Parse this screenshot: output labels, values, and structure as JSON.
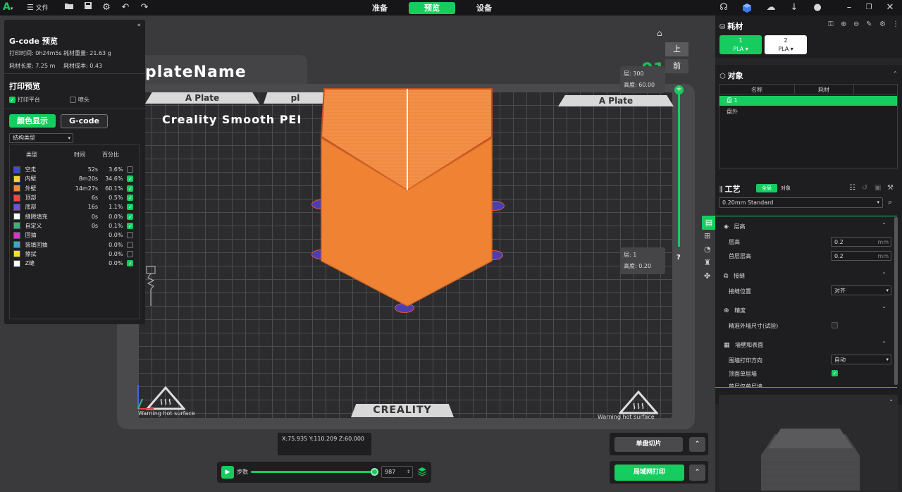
{
  "topbar": {
    "file_label": "文件",
    "tabs": [
      {
        "label": "准备"
      },
      {
        "label": "预览"
      },
      {
        "label": "设备"
      }
    ],
    "active_tab": "预览",
    "accent": "#17cc5f"
  },
  "viewport": {
    "plate_name": "plateName",
    "bed_labels": [
      "A Plate",
      "pl",
      "A Plate"
    ],
    "bed_title": "Creality Smooth PEI",
    "brand": "CREALITY",
    "warning_left": "Warning hot surface",
    "warning_right": "Warning hot surface",
    "view_top": "上",
    "view_front": "前",
    "view_number": "01",
    "layer_top": {
      "layer": "层: 300",
      "height": "高度: 60.00"
    },
    "layer_bottom": {
      "layer": "层: 1",
      "height": "高度: 0.20"
    },
    "help": "?",
    "coords": "X:75.935  Y:110.209  Z:60.000",
    "step_label": "步数",
    "step_value": "987",
    "slice_single": "单盘切片",
    "print_lan": "局域网打印",
    "model_color": "#f08a3c"
  },
  "left_panel": {
    "title": "G-code 预览",
    "print_time": "打印时间: 0h24m5s",
    "filament_weight": "耗材重量: 21.63 g",
    "filament_length": "耗材长度: 7.25 m",
    "filament_cost": "耗材成本: 0.43",
    "print_preview": "打印预览",
    "bed_option": "打印平台",
    "nozzle_option": "喷头",
    "color_button": "颜色显示",
    "gcode_button": "G-code",
    "select_value": "结构类型",
    "col_type": "类型",
    "col_time": "时间",
    "col_percent": "百分比",
    "rows": [
      {
        "name": "空走",
        "time": "52s",
        "pct": "3.6%",
        "color": "#3a4bd6",
        "checked": false
      },
      {
        "name": "内壁",
        "time": "8m20s",
        "pct": "34.6%",
        "color": "#f5d23a",
        "checked": true
      },
      {
        "name": "外壁",
        "time": "14m27s",
        "pct": "60.1%",
        "color": "#f08a3c",
        "checked": true
      },
      {
        "name": "顶部",
        "time": "6s",
        "pct": "0.5%",
        "color": "#e84a4a",
        "checked": true
      },
      {
        "name": "底部",
        "time": "16s",
        "pct": "1.1%",
        "color": "#7a4be0",
        "checked": true
      },
      {
        "name": "缝隙填充",
        "time": "0s",
        "pct": "0.0%",
        "color": "#ffffff",
        "checked": true
      },
      {
        "name": "自定义",
        "time": "0s",
        "pct": "0.1%",
        "color": "#3bb27a",
        "checked": true
      },
      {
        "name": "回抽",
        "time": "",
        "pct": "0.0%",
        "color": "#d536c8",
        "checked": false
      },
      {
        "name": "装填回抽",
        "time": "",
        "pct": "0.0%",
        "color": "#3aa7c7",
        "checked": false
      },
      {
        "name": "擦拭",
        "time": "",
        "pct": "0.0%",
        "color": "#f2e325",
        "checked": false
      },
      {
        "name": "Z缝",
        "time": "",
        "pct": "0.0%",
        "color": "#ffffff",
        "checked": true
      }
    ]
  },
  "right_panel": {
    "filament_title": "耗材",
    "filaments": [
      {
        "num": "1",
        "type": "PLA",
        "color": "#17cc5f"
      },
      {
        "num": "2",
        "type": "PLA",
        "color": "#ffffff"
      }
    ],
    "objects_title": "对象",
    "col_name": "名称",
    "col_filament": "耗材",
    "plate_item": "盘 1",
    "outside_item": "盘外",
    "process_title": "工艺",
    "tab_global": "全局",
    "tab_object": "对象",
    "preset": "0.20mm Standard",
    "sections": {
      "layer_height": "层高",
      "seam": "接缝",
      "precision": "精度",
      "walls": "墙壁和表面"
    },
    "params": {
      "layer_height_label": "层高",
      "layer_height_value": "0.2",
      "first_layer_label": "首层层高",
      "first_layer_value": "0.2",
      "unit": "mm",
      "seam_pos_label": "接缝位置",
      "seam_pos_value": "对齐",
      "precise_wall_label": "精准外墙尺寸(试验)",
      "wall_dir_label": "围墙打印方向",
      "wall_dir_value": "自动",
      "top_single_label": "顶面单层墙",
      "first_single_label": "首层仅单层墙"
    }
  }
}
